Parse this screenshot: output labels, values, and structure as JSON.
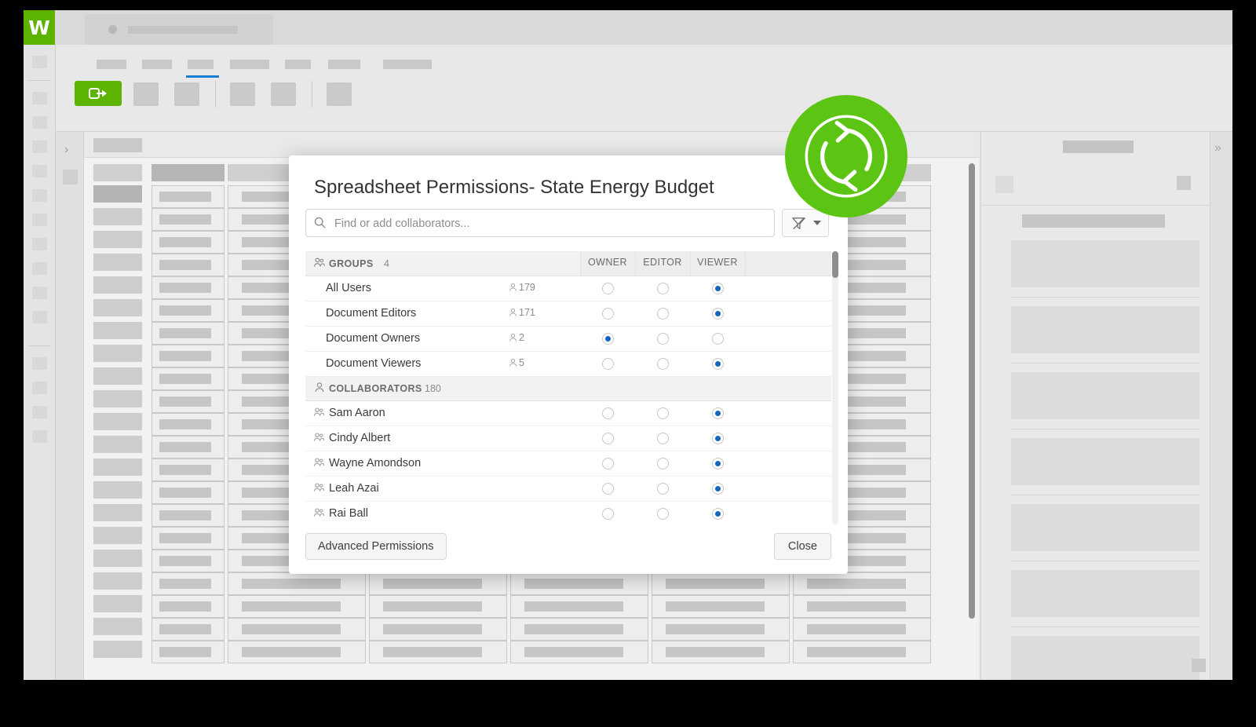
{
  "app": {
    "logo_letter": "W",
    "brand_green": "#5cb300",
    "accent_blue": "#1565c0",
    "sync_badge_color": "#5cc412",
    "sync_icon": "refresh-sync-icon",
    "expand_chevron": "›",
    "collapse_chevron": "»"
  },
  "modal": {
    "title": "Spreadsheet Permissions- State Energy Budget",
    "search": {
      "placeholder": "Find or add collaborators...",
      "value": "",
      "icon": "search-icon"
    },
    "filter_button": {
      "icon": "filter-off-icon",
      "caret": "chevron-down-icon"
    },
    "columns": [
      "OWNER",
      "EDITOR",
      "VIEWER"
    ],
    "groups_section": {
      "label": "GROUPS",
      "count": "4",
      "icon": "group-icon",
      "rows": [
        {
          "name": "All Users",
          "members": "179",
          "owner": false,
          "editor": false,
          "viewer": true
        },
        {
          "name": "Document Editors",
          "members": "171",
          "owner": false,
          "editor": false,
          "viewer": true
        },
        {
          "name": "Document Owners",
          "members": "2",
          "owner": true,
          "editor": false,
          "viewer": false
        },
        {
          "name": "Document Viewers",
          "members": "5",
          "owner": false,
          "editor": false,
          "viewer": true
        }
      ]
    },
    "collaborators_section": {
      "label": "COLLABORATORS",
      "count": "180",
      "icon": "person-icon",
      "rows": [
        {
          "name": "Sam Aaron",
          "owner": false,
          "editor": false,
          "viewer": true
        },
        {
          "name": "Cindy Albert",
          "owner": false,
          "editor": false,
          "viewer": true
        },
        {
          "name": "Wayne Amondson",
          "owner": false,
          "editor": false,
          "viewer": true
        },
        {
          "name": "Leah Azai",
          "owner": false,
          "editor": false,
          "viewer": true
        },
        {
          "name": "Rai Ball",
          "owner": false,
          "editor": false,
          "viewer": true
        },
        {
          "name": "",
          "owner": false,
          "editor": false,
          "viewer": true
        }
      ]
    },
    "advanced_permissions_label": "Advanced Permissions",
    "close_label": "Close"
  }
}
